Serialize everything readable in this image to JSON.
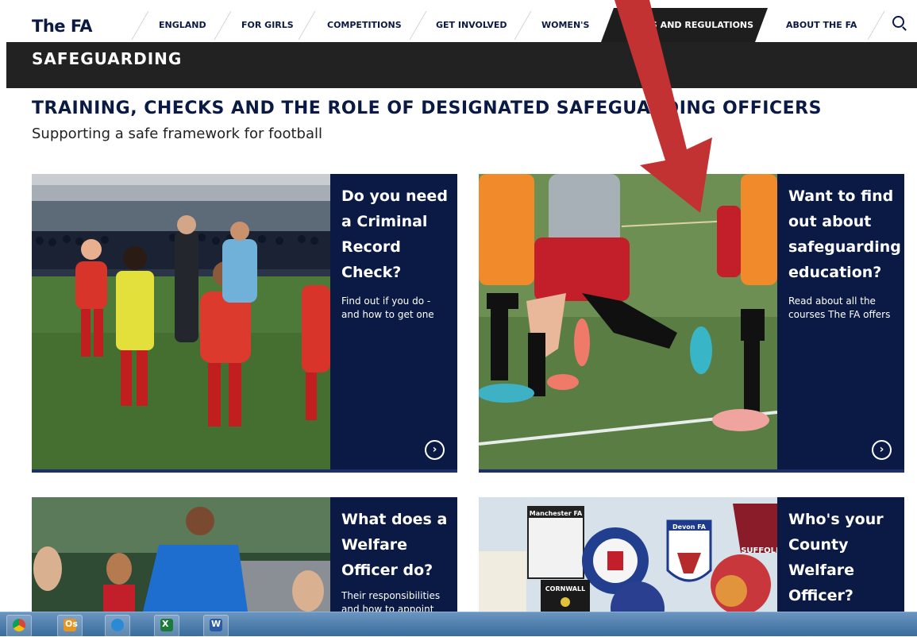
{
  "nav": {
    "logo": "The FA",
    "items": [
      "ENGLAND",
      "FOR GIRLS",
      "COMPETITIONS",
      "GET INVOLVED",
      "WOMEN'S"
    ],
    "active_item": "RULES AND REGULATIONS",
    "after_active": "ABOUT THE FA",
    "search_icon": "search-icon"
  },
  "section": {
    "title": "SAFEGUARDING"
  },
  "page": {
    "title": "TRAINING, CHECKS AND THE ROLE OF DESIGNATED SAFEGUARDING OFFICERS",
    "subtitle": "Supporting a safe  framework for football"
  },
  "cards": [
    {
      "title": "Do you need a Criminal Record Check?",
      "description": "Find out if you do - and how to get one",
      "arrow_icon": "chevron-right-circle-icon"
    },
    {
      "title": "Want to find out about safeguarding education?",
      "description": "Read about all the courses The FA offers",
      "arrow_icon": "chevron-right-circle-icon"
    },
    {
      "title": "What does a Welfare Officer do?",
      "description": "Their responsibilities and how to appoint"
    },
    {
      "title": "Who's your County Welfare Officer?"
    }
  ],
  "badges": {
    "manchester": "Manchester FA",
    "devon": "Devon FA",
    "cornwall": "CORNWALL",
    "suffolk": "SUFFOLK"
  },
  "taskbar": {
    "apps": [
      "chrome-icon",
      "outlook-icon",
      "internet-explorer-icon",
      "excel-icon",
      "word-icon"
    ],
    "outlook_label": "Os",
    "excel_label": "X",
    "word_label": "W"
  },
  "colors": {
    "navy": "#0a1a45",
    "section_bar": "#222222",
    "active_tab": "#1e1e1e",
    "annotation_arrow": "#c23232"
  }
}
